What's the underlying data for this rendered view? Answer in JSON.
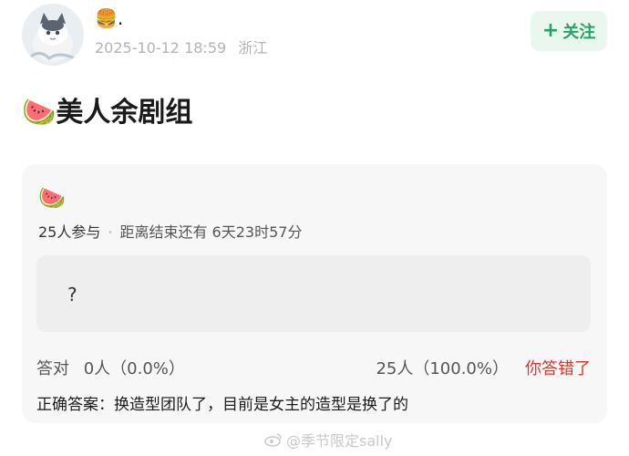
{
  "post": {
    "username": "🍔.",
    "date": "2025-10-12 18:59",
    "location": "浙江",
    "follow_label": "关注",
    "title_emoji": "🍉",
    "title": "美人余剧组"
  },
  "poll": {
    "emoji": "🍉",
    "participants": "25人参与",
    "deadline": "距离结束还有 6天23时57分",
    "option_text": "?",
    "correct_label": "答对",
    "correct_count": "0人（0.0%）",
    "wrong_count": "25人（100.0%）",
    "wrong_status": "你答错了",
    "answer": "正确答案：换造型团队了，目前是女主的造型是换了的"
  },
  "watermark": {
    "text": "@季节限定sally"
  }
}
